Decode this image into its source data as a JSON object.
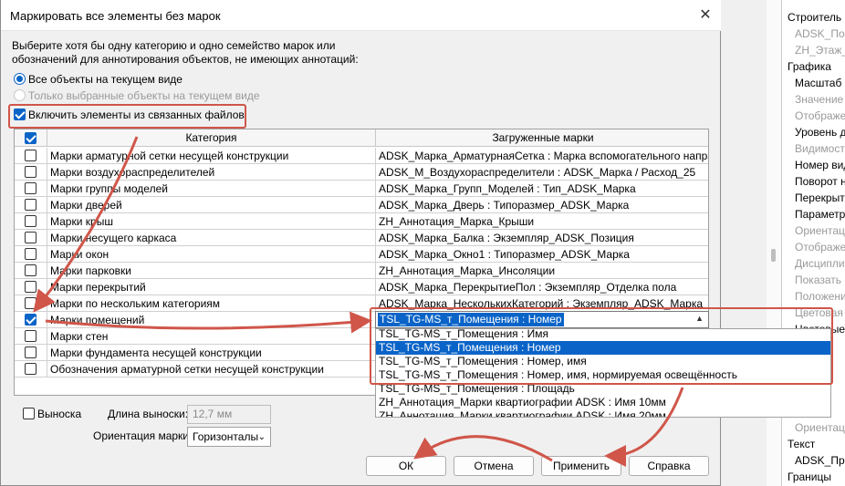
{
  "dialog": {
    "title": "Маркировать все элементы без марок",
    "instruction": "Выберите хотя бы одну категорию и одно семейство марок или обозначений для аннотирования объектов, не имеющих аннотаций:",
    "radio_all": "Все объекты на текущем виде",
    "radio_selected": "Только выбранные объекты на текущем виде",
    "include_linked": "Включить элементы из связанных файлов",
    "include_linked_checked": true
  },
  "table": {
    "headers": [
      "Категория",
      "Загруженные марки"
    ],
    "rows": [
      {
        "checked": false,
        "category": "Марки арматурной сетки несущей конструкции",
        "tag": "ADSK_Марка_АрматурнаяСетка : Марка вспомогательного напра"
      },
      {
        "checked": false,
        "category": "Марки воздухораспределителей",
        "tag": "ADSK_M_Воздухораспределители : ADSK_Марка / Расход_25"
      },
      {
        "checked": false,
        "category": "Марки группы моделей",
        "tag": "ADSK_Марка_Групп_Моделей : Тип_ADSK_Марка"
      },
      {
        "checked": false,
        "category": "Марки дверей",
        "tag": "ADSK_Марка_Дверь : Типоразмер_ADSK_Марка"
      },
      {
        "checked": false,
        "category": "Марки крыш",
        "tag": "ZH_Аннотация_Марка_Крыши"
      },
      {
        "checked": false,
        "category": "Марки несущего каркаса",
        "tag": "ADSK_Марка_Балка : Экземпляр_ADSK_Позиция"
      },
      {
        "checked": false,
        "category": "Марки окон",
        "tag": "ADSK_Марка_Окно1 : Типоразмер_ADSK_Марка"
      },
      {
        "checked": false,
        "category": "Марки парковки",
        "tag": "ZH_Аннотация_Марка_Инсоляции"
      },
      {
        "checked": false,
        "category": "Марки перекрытий",
        "tag": "ADSK_Марка_ПерекрытиеПол : Экземпляр_Отделка пола"
      },
      {
        "checked": false,
        "category": "Марки по нескольким категориям",
        "tag": "ADSK_Марка_НесколькихКатегорий : Экземпляр_ADSK_Марка"
      },
      {
        "checked": true,
        "category": "Марки помещений",
        "tag": ""
      },
      {
        "checked": false,
        "category": "Марки стен",
        "tag": ""
      },
      {
        "checked": false,
        "category": "Марки фундамента несущей конструкции",
        "tag": ""
      },
      {
        "checked": false,
        "category": "Обозначения арматурной сетки несущей конструкции",
        "tag": ""
      }
    ]
  },
  "dropdown": {
    "selected": "TSL_TG-MS_т_Помещения : Номер",
    "options": [
      {
        "label": "TSL_TG-MS_т_Помещения : Имя",
        "selected": false
      },
      {
        "label": "TSL_TG-MS_т_Помещения : Номер",
        "selected": true
      },
      {
        "label": "TSL_TG-MS_т_Помещения : Номер, имя",
        "selected": false
      },
      {
        "label": "TSL_TG-MS_т_Помещения : Номер, имя, нормируемая освещённость",
        "selected": false
      },
      {
        "label": "TSL_TG-MS_т_Помещения : Площадь",
        "selected": false
      },
      {
        "label": "ZH_Аннотация_Марки квартиографии ADSK : Имя 10мм",
        "selected": false
      },
      {
        "label": "ZH_Аннотация_Марки квартиографии ADSK : Имя 20мм",
        "selected": false
      }
    ]
  },
  "options": {
    "leader_label": "Выноска",
    "leader_length_label": "Длина выноски:",
    "leader_length_value": "12,7 мм",
    "orientation_label": "Ориентация марки:",
    "orientation_value": "Горизонталы"
  },
  "buttons": {
    "ok": "ОК",
    "cancel": "Отмена",
    "apply": "Применить",
    "help": "Справка"
  },
  "properties_panel": {
    "items": [
      {
        "text": "Строитель",
        "style": "h"
      },
      {
        "text": "ADSK_Пози",
        "style": "g"
      },
      {
        "text": "ZH_Этаж_Ч",
        "style": "g"
      },
      {
        "text": "Графика",
        "style": "h"
      },
      {
        "text": "Масштаб в",
        "style": "n"
      },
      {
        "text": "Значение",
        "style": "g"
      },
      {
        "text": "Отображе",
        "style": "g"
      },
      {
        "text": "Уровень д",
        "style": "n"
      },
      {
        "text": "Видимость",
        "style": "g"
      },
      {
        "text": "Номер вид",
        "style": "n"
      },
      {
        "text": "Поворот н",
        "style": "n"
      },
      {
        "text": "Перекрыт",
        "style": "n"
      },
      {
        "text": "Параметр",
        "style": "n"
      },
      {
        "text": "Ориентаци",
        "style": "g"
      },
      {
        "text": "Отображе",
        "style": "g"
      },
      {
        "text": "Дисципли",
        "style": "g"
      },
      {
        "text": "Показать н",
        "style": "g"
      },
      {
        "text": "Положени",
        "style": "g"
      },
      {
        "text": "Цветовая с",
        "style": "g"
      },
      {
        "text": "Цветовые",
        "style": "n"
      },
      {
        "text": "Ориентаци",
        "style": "g"
      },
      {
        "text": "Текст",
        "style": "h"
      },
      {
        "text": "ADSK_При",
        "style": "n"
      },
      {
        "text": "Границы",
        "style": "h"
      }
    ]
  },
  "colors": {
    "accent": "#0a64c8",
    "annotation": "#d0564a"
  }
}
